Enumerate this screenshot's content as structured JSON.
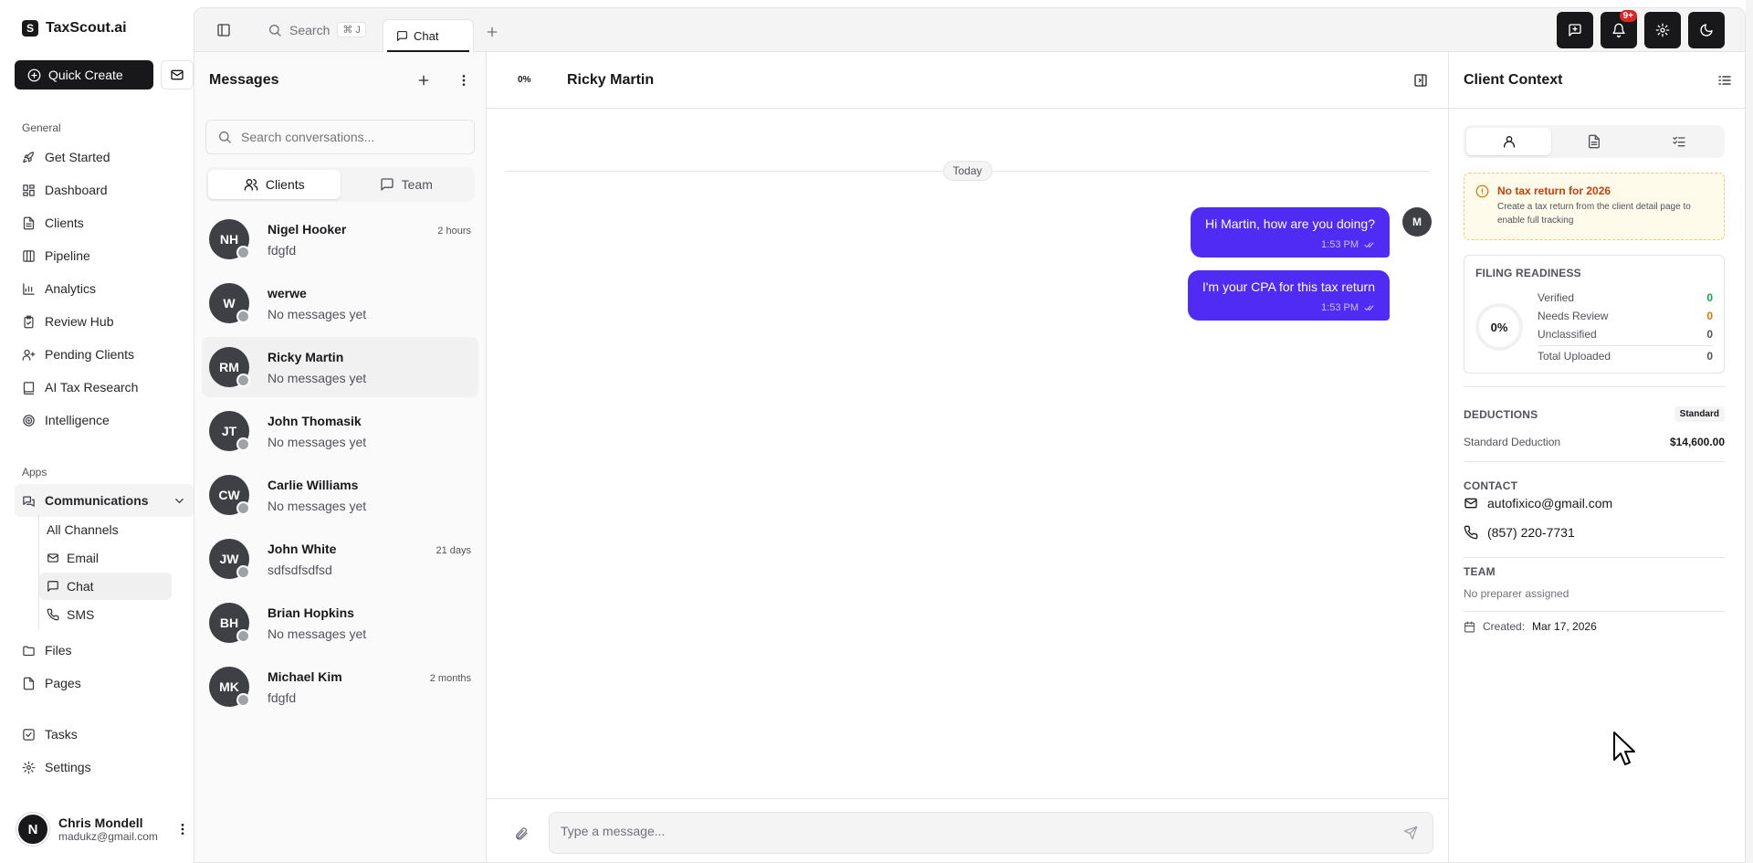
{
  "brand": {
    "name": "TaxScout.ai",
    "logo_letter": "S"
  },
  "sidebar": {
    "quick_create": "Quick Create",
    "general_label": "General",
    "general_items": [
      {
        "label": "Get Started",
        "icon": "rocket-icon"
      },
      {
        "label": "Dashboard",
        "icon": "dashboard-icon"
      },
      {
        "label": "Clients",
        "icon": "document-icon"
      },
      {
        "label": "Pipeline",
        "icon": "columns-icon"
      },
      {
        "label": "Analytics",
        "icon": "chart-icon"
      },
      {
        "label": "Review Hub",
        "icon": "clipboard-icon"
      },
      {
        "label": "Pending Clients",
        "icon": "user-plus-icon"
      },
      {
        "label": "AI Tax Research",
        "icon": "book-icon"
      },
      {
        "label": "Intelligence",
        "icon": "radar-icon"
      }
    ],
    "apps_label": "Apps",
    "communications": "Communications",
    "comm_sub": [
      {
        "label": "All Channels"
      },
      {
        "label": "Email",
        "icon": "mail-icon"
      },
      {
        "label": "Chat",
        "icon": "chat-icon"
      },
      {
        "label": "SMS",
        "icon": "phone-icon"
      }
    ],
    "apps_items": [
      {
        "label": "Files",
        "icon": "folder-icon"
      },
      {
        "label": "Pages",
        "icon": "page-icon"
      }
    ],
    "bottom_items": [
      {
        "label": "Tasks",
        "icon": "task-icon"
      },
      {
        "label": "Settings",
        "icon": "gear-icon"
      }
    ],
    "user": {
      "initial": "N",
      "name": "Chris Mondell",
      "email": "madukz@gmail.com"
    }
  },
  "topbar": {
    "search": "Search",
    "shortcut": "⌘ J",
    "tab": "Chat",
    "notif_badge": "9+"
  },
  "messages": {
    "title": "Messages",
    "search_placeholder": "Search conversations...",
    "tabs": [
      "Clients",
      "Team"
    ],
    "conversations": [
      {
        "initials": "NH",
        "name": "Nigel Hooker",
        "time": "2 hours",
        "preview": "fdgfd"
      },
      {
        "initials": "W",
        "name": "werwe",
        "time": "",
        "preview": "No messages yet"
      },
      {
        "initials": "RM",
        "name": "Ricky Martin",
        "time": "",
        "preview": "No messages yet"
      },
      {
        "initials": "JT",
        "name": "John Thomasik",
        "time": "",
        "preview": "No messages yet"
      },
      {
        "initials": "CW",
        "name": "Carlie Williams",
        "time": "",
        "preview": "No messages yet"
      },
      {
        "initials": "JW",
        "name": "John White",
        "time": "21 days",
        "preview": "sdfsdfsdfsd"
      },
      {
        "initials": "BH",
        "name": "Brian Hopkins",
        "time": "",
        "preview": "No messages yet"
      },
      {
        "initials": "MK",
        "name": "Michael Kim",
        "time": "2 months",
        "preview": "fdgfd"
      }
    ]
  },
  "chat": {
    "progress": "0%",
    "client_name": "Ricky Martin",
    "day_divider": "Today",
    "me_initial": "M",
    "messages": [
      {
        "text": "Hi Martin, how are you doing?",
        "time": "1:53 PM"
      },
      {
        "text": "I'm your CPA for this tax return",
        "time": "1:53 PM"
      }
    ],
    "input_placeholder": "Type a message...",
    "bubble_color": "#4f2bf3"
  },
  "context": {
    "title": "Client Context",
    "alert_title": "No tax return for 2026",
    "alert_body": "Create a tax return from the client detail page to enable full tracking",
    "readiness_title": "FILING READINESS",
    "readiness_pct": "0%",
    "readiness_rows": [
      {
        "label": "Verified",
        "value": "0",
        "color": "#16a34a"
      },
      {
        "label": "Needs Review",
        "value": "0",
        "color": "#d97706"
      },
      {
        "label": "Unclassified",
        "value": "0",
        "color": "#18181b"
      },
      {
        "label": "Total Uploaded",
        "value": "0",
        "color": "#18181b"
      }
    ],
    "deductions_title": "DEDUCTIONS",
    "deductions_badge": "Standard",
    "deduction_label": "Standard Deduction",
    "deduction_value": "$14,600.00",
    "contact_title": "CONTACT",
    "email": "autofixico@gmail.com",
    "phone": "(857) 220-7731",
    "team_title": "TEAM",
    "team_value": "No preparer assigned",
    "created_label": "Created:",
    "created_value": "Mar 17, 2026"
  }
}
